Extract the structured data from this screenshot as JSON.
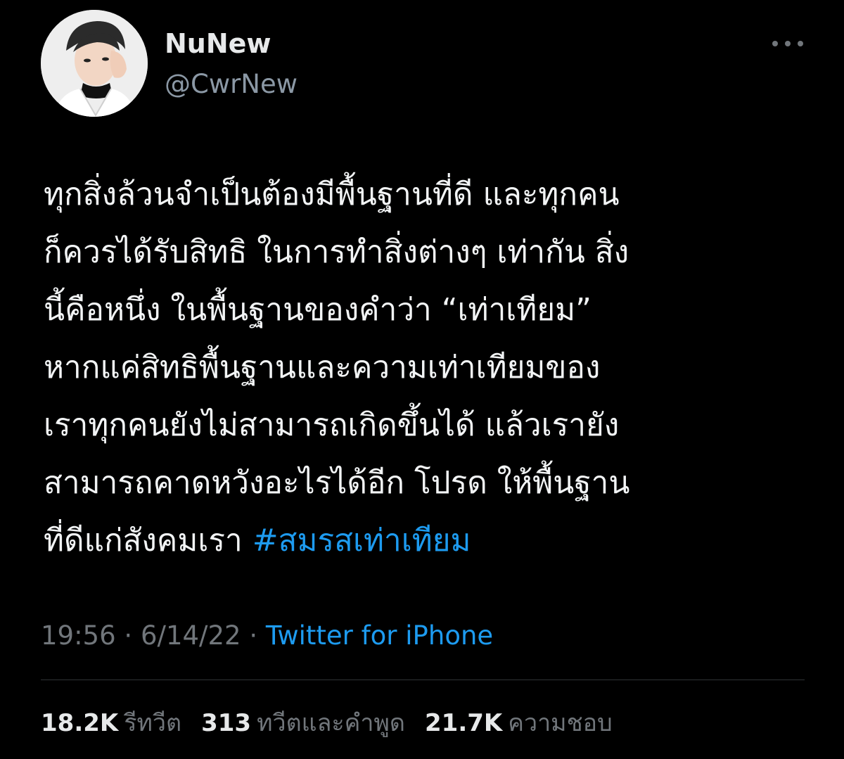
{
  "user": {
    "display_name": "NuNew",
    "handle": "@CwrNew"
  },
  "tweet": {
    "lines": [
      "ทุกสิ่งล้วนจำเป็นต้องมีพื้นฐานที่ดี และทุกคน",
      "ก็ควรได้รับสิทธิ ในการทำสิ่งต่างๆ เท่ากัน สิ่ง",
      "นี้คือหนึ่ง ในพื้นฐานของคำว่า “เท่าเทียม”",
      "หากแค่สิทธิพื้นฐานและความเท่าเทียมของ",
      "เราทุกคนยังไม่สามารถเกิดขึ้นได้ แล้วเรายัง",
      "สามารถคาดหวังอะไรได้อีก โปรด ให้พื้นฐาน"
    ],
    "last_line_text": "ที่ดีแก่สังคมเรา ",
    "hashtag": "#สมรสเท่าเทียม"
  },
  "meta": {
    "time": "19:56",
    "date": "6/14/22",
    "separator": " · ",
    "source": "Twitter for iPhone"
  },
  "stats": {
    "retweets": {
      "count": "18.2K",
      "label": "รีทวีต"
    },
    "quotes": {
      "count": "313",
      "label": "ทวีตและคำพูด"
    },
    "likes": {
      "count": "21.7K",
      "label": "ความชอบ"
    }
  },
  "icons": {
    "more": "more-horizontal-icon",
    "avatar": "profile-avatar"
  },
  "colors": {
    "background": "#000000",
    "text": "#e7e9ea",
    "secondary": "#71767b",
    "link": "#1d9bf0",
    "divider": "#2f3336"
  }
}
